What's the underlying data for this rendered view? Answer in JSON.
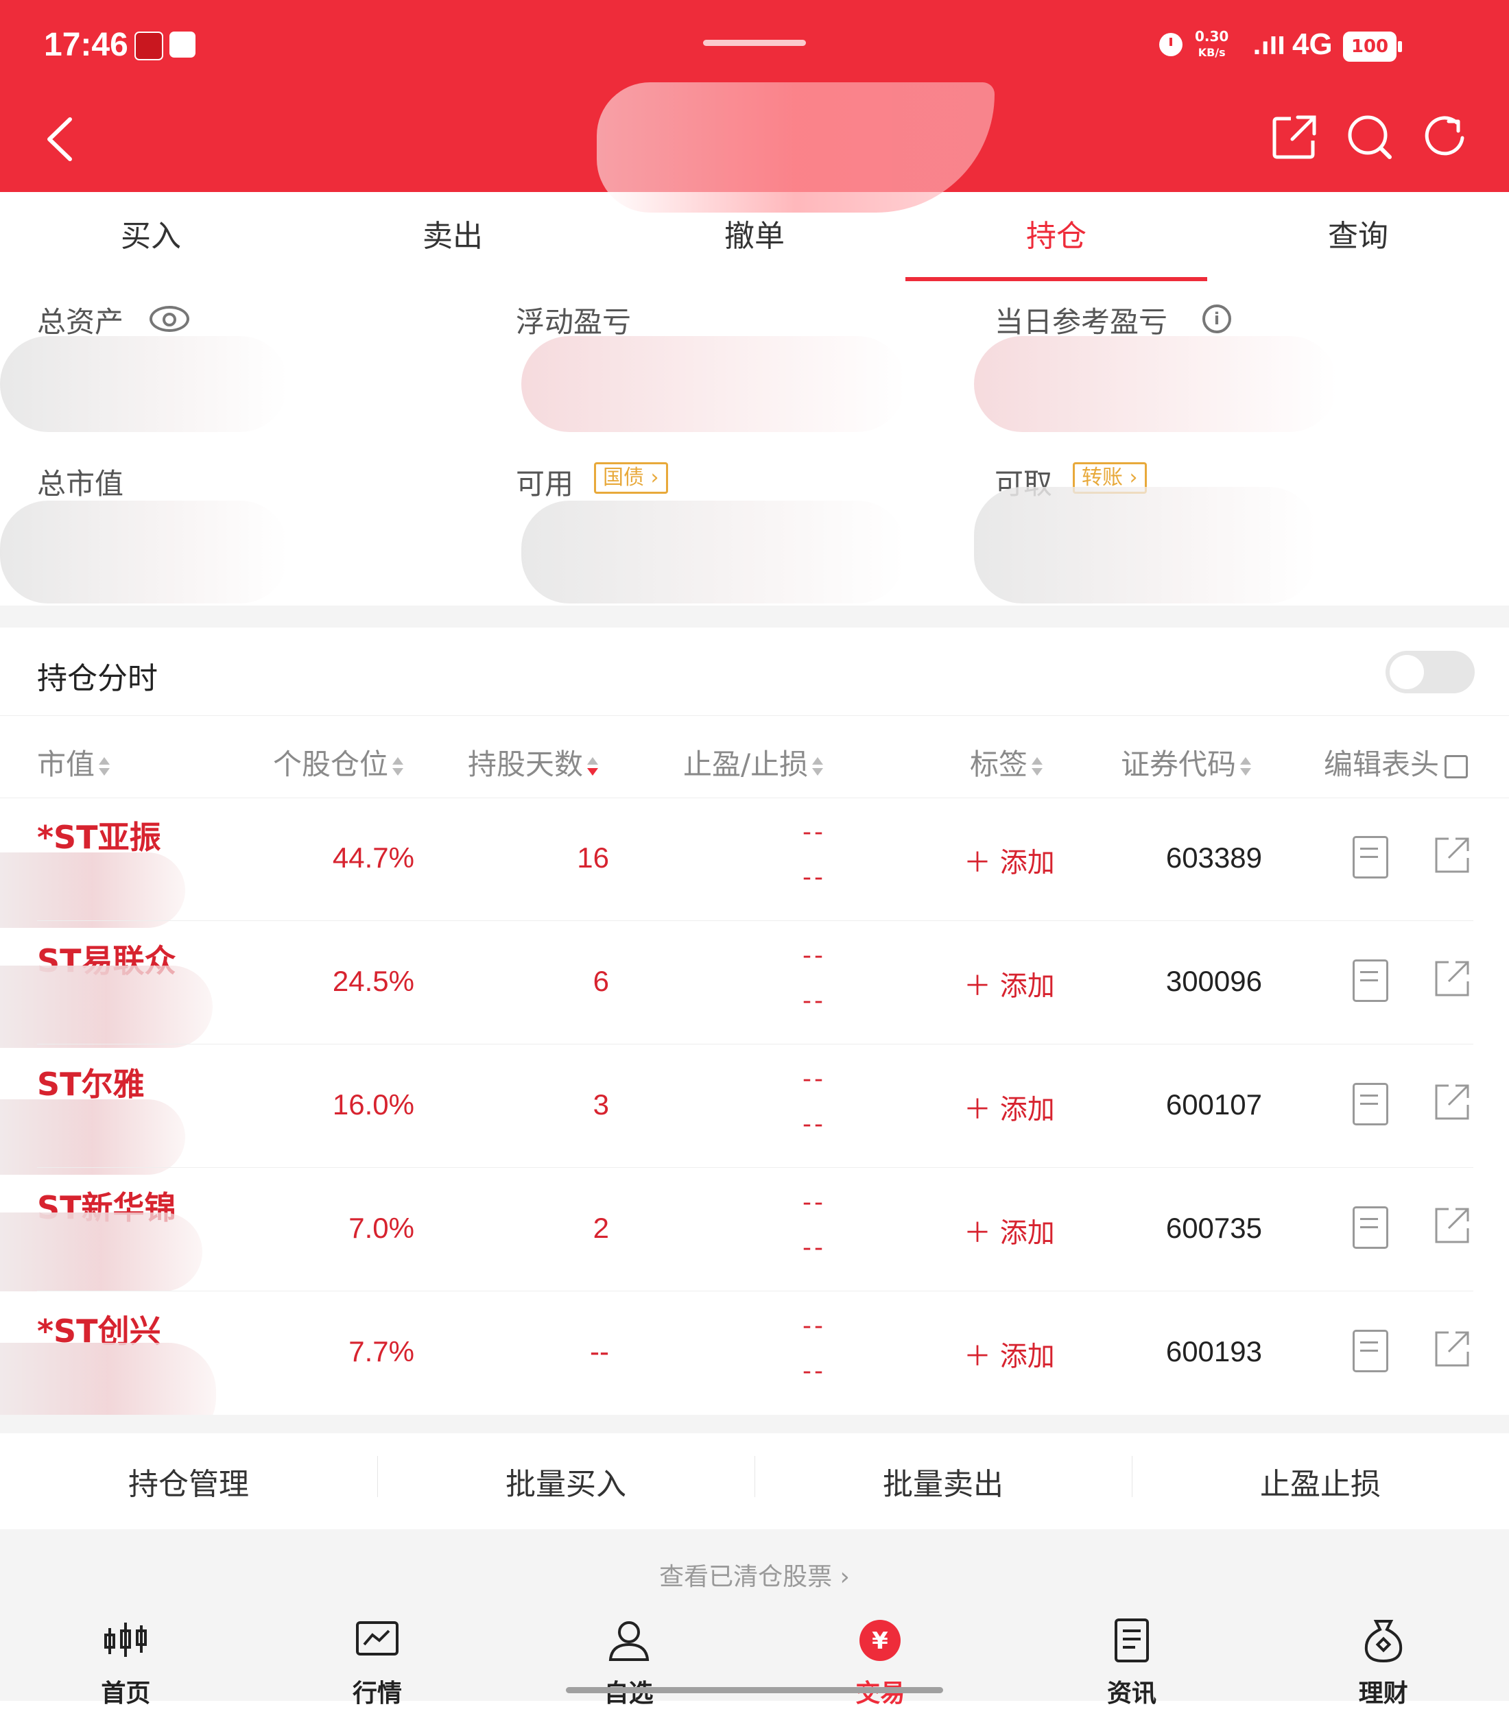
{
  "status_bar": {
    "time": "17:46",
    "speed_top": "0.30",
    "speed_unit": "KB/s",
    "network": "4G",
    "battery": "100"
  },
  "header": {
    "title": ""
  },
  "tabs": [
    {
      "label": "买入"
    },
    {
      "label": "卖出"
    },
    {
      "label": "撤单"
    },
    {
      "label": "持仓",
      "active": true
    },
    {
      "label": "查询"
    }
  ],
  "summary": {
    "total_assets_label": "总资产",
    "floating_pl_label": "浮动盈亏",
    "daily_pl_label": "当日参考盈亏",
    "market_value_label": "总市值",
    "available_label": "可用",
    "available_tag": "国债",
    "withdrawable_label": "可取",
    "withdrawable_tag": "转账"
  },
  "position_timeshare": {
    "label": "持仓分时",
    "enabled": false
  },
  "table": {
    "headers": {
      "market_value": "市值",
      "position_pct": "个股仓位",
      "hold_days": "持股天数",
      "take_profit_stop_loss": "止盈/止损",
      "tag": "标签",
      "security_code": "证券代码",
      "edit_header": "编辑表头"
    },
    "rows": [
      {
        "name": "*ST亚振",
        "pct": "44.7%",
        "days": "16",
        "tp": "--",
        "sl": "--",
        "tag": "添加",
        "code": "603389"
      },
      {
        "name": "ST易联众",
        "pct": "24.5%",
        "days": "6",
        "tp": "--",
        "sl": "--",
        "tag": "添加",
        "code": "300096"
      },
      {
        "name": "ST尔雅",
        "pct": "16.0%",
        "days": "3",
        "tp": "--",
        "sl": "--",
        "tag": "添加",
        "code": "600107"
      },
      {
        "name": "ST新华锦",
        "pct": "7.0%",
        "days": "2",
        "tp": "--",
        "sl": "--",
        "tag": "添加",
        "code": "600735"
      },
      {
        "name": "*ST创兴",
        "pct": "7.7%",
        "days": "--",
        "tp": "--",
        "sl": "--",
        "tag": "添加",
        "code": "600193"
      }
    ]
  },
  "actions": {
    "manage": "持仓管理",
    "batch_buy": "批量买入",
    "batch_sell": "批量卖出",
    "tp_sl": "止盈止损"
  },
  "cleared_link": "查看已清仓股票",
  "bottom_nav": [
    {
      "label": "首页",
      "icon": "candlestick-icon"
    },
    {
      "label": "行情",
      "icon": "market-chart-icon"
    },
    {
      "label": "自选",
      "icon": "user-icon"
    },
    {
      "label": "交易",
      "icon": "yen-icon",
      "active": true
    },
    {
      "label": "资讯",
      "icon": "document-icon"
    },
    {
      "label": "理财",
      "icon": "money-bag-icon"
    }
  ],
  "colors": {
    "brand_red": "#ee2c3a",
    "price_red": "#d7232f",
    "tag_orange": "#e8a93b"
  }
}
